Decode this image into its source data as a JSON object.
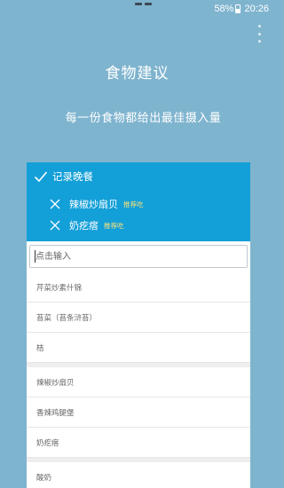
{
  "status_bar": {
    "battery": "58%",
    "time": "20:26"
  },
  "header": {
    "title": "食物建议",
    "subtitle": "每一份食物都给出最佳摄入量"
  },
  "card": {
    "meal_label": "记录晚餐",
    "selected_foods": [
      {
        "name": "辣椒炒扇贝",
        "tag": "推荐吃"
      },
      {
        "name": "奶疙瘩",
        "tag": "推荐吃"
      }
    ],
    "search": {
      "placeholder": "点击输入"
    },
    "suggestion_groups": [
      [
        "芹菜炒素什锦",
        "苔菜（苔条浒苔）",
        "桔"
      ],
      [
        "辣椒炒扇贝",
        "香辣鸡腿堡",
        "奶疙瘩"
      ],
      [
        "酸奶"
      ]
    ]
  },
  "icons": {
    "more": "more-vert-icon",
    "check": "check-icon",
    "remove": "close-icon"
  },
  "colors": {
    "background": "#7fb4cf",
    "header": "#139fd8",
    "tag": "#ffe37a"
  }
}
